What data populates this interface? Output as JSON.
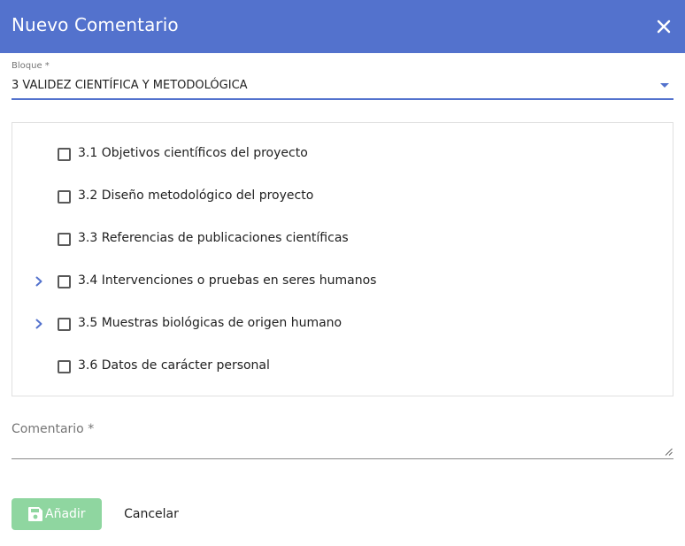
{
  "dialog": {
    "title": "Nuevo Comentario",
    "close_icon": "close-icon"
  },
  "bloque": {
    "label": "Bloque *",
    "value": "3 VALIDEZ CIENTÍFICA Y METODOLÓGICA"
  },
  "tree": {
    "items": [
      {
        "label": "3.1 Objetivos científicos del proyecto",
        "expandable": false,
        "checked": false
      },
      {
        "label": "3.2 Diseño metodológico del proyecto",
        "expandable": false,
        "checked": false
      },
      {
        "label": "3.3 Referencias de publicaciones científicas",
        "expandable": false,
        "checked": false
      },
      {
        "label": "3.4 Intervenciones o pruebas en seres humanos",
        "expandable": true,
        "checked": false
      },
      {
        "label": "3.5 Muestras biológicas de origen humano",
        "expandable": true,
        "checked": false
      },
      {
        "label": "3.6 Datos de carácter personal",
        "expandable": false,
        "checked": false
      }
    ]
  },
  "comentario": {
    "label": "Comentario *",
    "value": ""
  },
  "actions": {
    "add_label": "Añadir",
    "add_icon": "save-icon",
    "cancel_label": "Cancelar"
  },
  "colors": {
    "header": "#5372cd",
    "accent": "#5372cd",
    "add_button_disabled": "#8fd6a0"
  }
}
